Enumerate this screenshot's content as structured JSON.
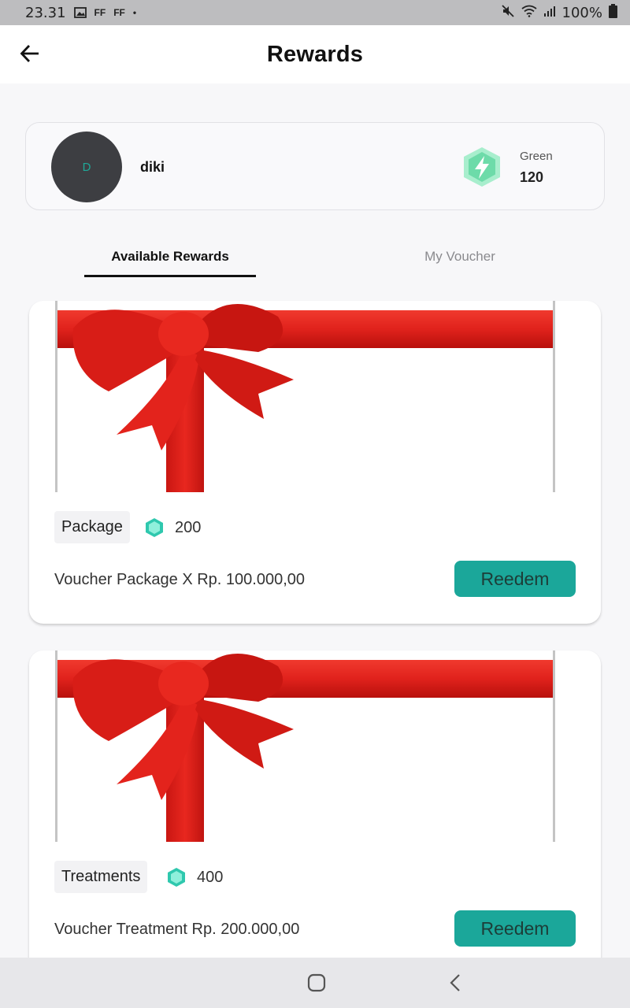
{
  "status_bar": {
    "time": "23.31",
    "notif_1": "FF",
    "notif_2": "FF",
    "notif_dot": "•",
    "battery": "100%"
  },
  "header": {
    "title": "Rewards",
    "back_icon": "arrow-left-icon"
  },
  "profile": {
    "avatar_initial": "D",
    "name": "diki",
    "tier_label": "Green",
    "points": "120",
    "tier_icon": "lightning-hexagon-icon"
  },
  "tabs": [
    {
      "label": "Available Rewards",
      "active": true
    },
    {
      "label": "My Voucher",
      "active": false
    }
  ],
  "rewards": [
    {
      "category": "Package",
      "cost": "200",
      "title": "Voucher Package X Rp. 100.000,00",
      "button": "Reedem"
    },
    {
      "category": "Treatments",
      "cost": "400",
      "title": "Voucher Treatment Rp. 200.000,00",
      "button": "Reedem"
    }
  ],
  "colors": {
    "accent": "#1ba79a",
    "ribbon": "#e0221c",
    "badge_green": "#7be3b5"
  },
  "nav": {
    "home_icon": "home-square-icon",
    "back_icon": "back-chevron-icon"
  }
}
